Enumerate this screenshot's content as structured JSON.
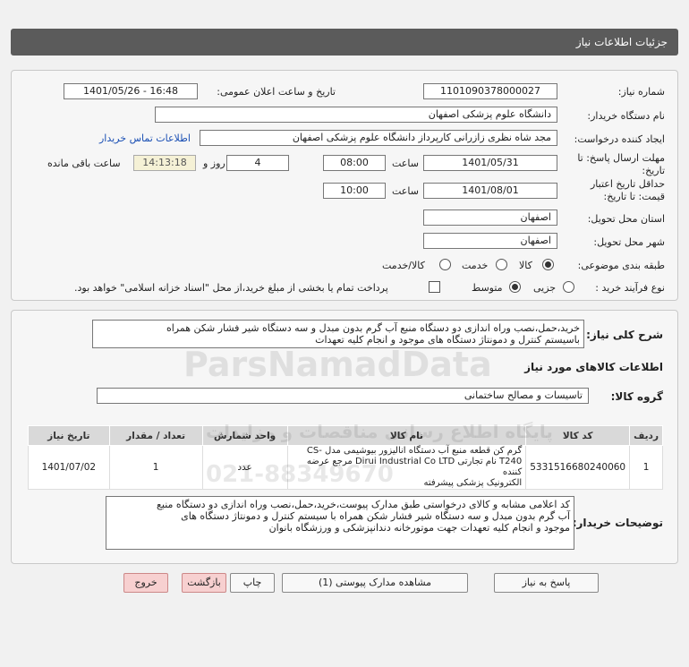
{
  "header": {
    "title": "جزئیات اطلاعات نیاز"
  },
  "form": {
    "need_number_label": "شماره نیاز:",
    "need_number": "1101090378000027",
    "announce_label": "تاریخ و ساعت اعلان عمومی:",
    "announce_value": "1401/05/26 - 16:48",
    "buyer_org_label": "نام دستگاه خریدار:",
    "buyer_org": "دانشگاه علوم پزشکی اصفهان",
    "requester_label": "ایجاد کننده درخواست:",
    "requester": "مجد شاه نظری زازرانی کارپرداز دانشگاه علوم پزشکی اصفهان",
    "contact_link": "اطلاعات تماس خریدار",
    "deadline_label_1": "مهلت ارسال پاسخ: تا",
    "deadline_label_2": "تاریخ:",
    "deadline_date": "1401/05/31",
    "time_word": "ساعت",
    "deadline_time": "08:00",
    "days_value": "4",
    "days_and_word": "روز و",
    "remaining_time": "14:13:18",
    "remaining_label": "ساعت باقی مانده",
    "validity_label_1": "حداقل تاریخ اعتبار",
    "validity_label_2": "قیمت: تا تاریخ:",
    "validity_date": "1401/08/01",
    "validity_time": "10:00",
    "province_label": "استان محل تحویل:",
    "province": "اصفهان",
    "city_label": "شهر محل تحویل:",
    "city": "اصفهان",
    "category_label": "طبقه بندی موضوعی:",
    "category_options": [
      "کالا",
      "خدمت",
      "کالا/خدمت"
    ],
    "process_label": "نوع فرآیند خرید :",
    "process_options": [
      "جزیی",
      "متوسط"
    ],
    "payment_note": "پرداخت تمام یا بخشی از مبلغ خرید،از محل \"اسناد خزانه اسلامی\" خواهد بود."
  },
  "details": {
    "summary_label": "شرح کلی نیاز:",
    "summary_line1": "خرید،حمل،نصب وراه اندازی دو دستگاه منبع آب گرم بدون مبدل و سه دستگاه شیر فشار شکن همراه",
    "summary_line2": "باسیستم کنترل و دمونتاژ دستگاه های موجود و انجام کلیه تعهدات",
    "goods_info_title": "اطلاعات کالاهای مورد نیاز",
    "goods_group_label": "گروه کالا:",
    "goods_group": "تاسیسات و مصالح ساختمانی",
    "table": {
      "headers": [
        "ردیف",
        "کد کالا",
        "نام کالا",
        "واحد شمارش",
        "تعداد / مقدار",
        "تاریخ نیاز"
      ],
      "rows": [
        {
          "row": "1",
          "code": "5331516680240060",
          "name_line1": "گرم کن قطعه منبع آب دستگاه انالیزور بیوشیمی مدل -CS",
          "name_line2": "T240 نام تجارتی Dirui Industrial Co LTD مرجع عرضه کننده",
          "name_line3": "الکترونیک پزشکی پیشرفته",
          "unit": "عدد",
          "qty": "1",
          "date": "1401/07/02"
        }
      ]
    },
    "buyer_notes_label": "توضیحات خریدار:",
    "buyer_notes_line1": "کد اعلامی مشابه و کالای درخواستی طبق مدارک پیوست،خرید،حمل،نصب وراه اندازی دو دستگاه منبع",
    "buyer_notes_line2": "آب گرم بدون مبدل و سه دستگاه شیر فشار شکن همراه با سیستم کنترل و دمونتاژ دستگاه های",
    "buyer_notes_line3": "موجود و انجام کلیه تعهدات جهت موتورخانه دندانپزشکی و ورزشگاه بانوان"
  },
  "buttons": {
    "reply": "پاسخ به نیاز",
    "attachments": "مشاهده مدارک پیوستی (1)",
    "print": "چاپ",
    "back": "بازگشت",
    "exit": "خروج"
  },
  "watermark": {
    "line1": "ParsNamadData",
    "line2": "پایگاه اطلاع رسانی مناقصات و مزایدات",
    "line3": "021-88349670"
  },
  "colors": {
    "header_bg": "#5b5b5b",
    "link": "#1a4fb4",
    "red_button": "#f7d0d0",
    "timer_bg": "#f5f1d6"
  }
}
